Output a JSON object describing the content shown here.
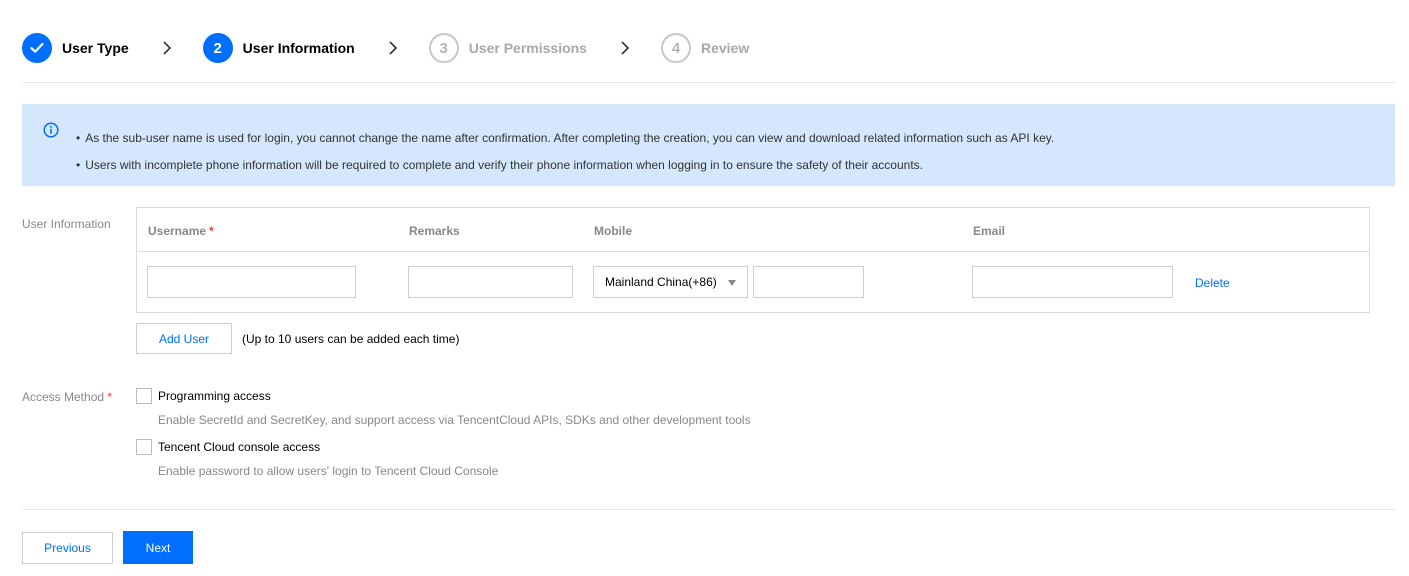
{
  "steps": [
    {
      "number": "",
      "label": "User Type",
      "state": "done"
    },
    {
      "number": "2",
      "label": "User Information",
      "state": "active"
    },
    {
      "number": "3",
      "label": "User Permissions",
      "state": "pending"
    },
    {
      "number": "4",
      "label": "Review",
      "state": "pending"
    }
  ],
  "alert": {
    "icon": "info-icon",
    "bullet": "•",
    "lines": [
      "As the sub-user name is used for login, you cannot change the name after confirmation. After completing the creation, you can view and download related information such as API key.",
      "Users with incomplete phone information will be required to complete and verify their phone information when logging in to ensure the safety of their accounts."
    ]
  },
  "user_info": {
    "label": "User Information",
    "columns": {
      "username": "Username",
      "username_required": "*",
      "remarks": "Remarks",
      "mobile": "Mobile",
      "email": "Email"
    },
    "row": {
      "username": "",
      "remarks": "",
      "country_code": "Mainland China(+86)",
      "phone": "",
      "email": "",
      "delete_label": "Delete"
    },
    "add_user_label": "Add User",
    "add_user_note": "(Up to 10 users can be added each time)"
  },
  "access_method": {
    "label": "Access Method",
    "required": "*",
    "options": [
      {
        "label": "Programming access",
        "description": "Enable SecretId and SecretKey, and support access via TencentCloud APIs, SDKs and other development tools",
        "checked": false
      },
      {
        "label": "Tencent Cloud console access",
        "description": "Enable password to allow users' login to Tencent Cloud Console",
        "checked": false
      }
    ]
  },
  "footer": {
    "previous_label": "Previous",
    "next_label": "Next"
  },
  "colors": {
    "accent": "#006eff",
    "alert_bg": "#d5e7fd",
    "required": "#e54545"
  }
}
